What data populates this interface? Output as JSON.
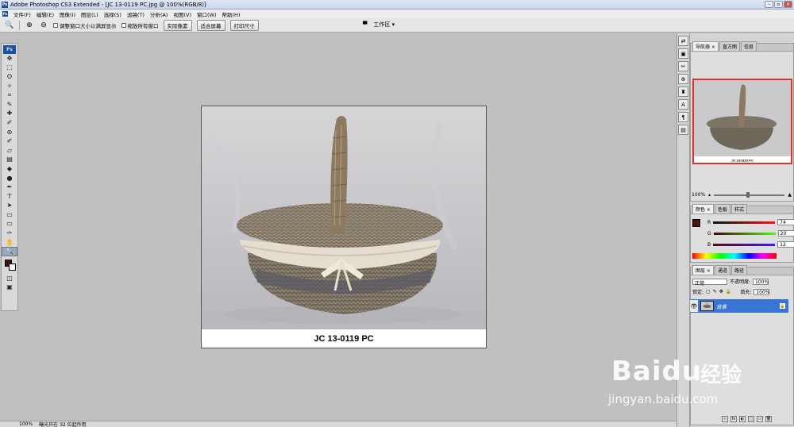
{
  "window": {
    "title": "Adobe Photoshop CS3 Extended - [JC 13-0119 PC.jpg @ 100%(RGB/8)]",
    "app_icon": "Ps",
    "minimize": "–",
    "restore": "▫",
    "close": "×"
  },
  "menubar": {
    "icon": "Ps",
    "items": [
      "文件(F)",
      "编辑(E)",
      "图像(I)",
      "图层(L)",
      "选择(S)",
      "滤镜(T)",
      "分析(A)",
      "视图(V)",
      "窗口(W)",
      "帮助(H)"
    ]
  },
  "options": {
    "zoom_in": "⊕",
    "zoom_out": "⊖",
    "resize_windows": "调整窗口大小以满屏显示",
    "zoom_all": "缩放所有窗口",
    "actual_pixels": "实际像素",
    "fit_screen": "适合屏幕",
    "print_size": "打印尺寸",
    "workspace": "工作区 ▾"
  },
  "toolbox": {
    "logo": "Ps",
    "tools": [
      "move",
      "marquee",
      "lasso",
      "magic-wand",
      "crop",
      "slice",
      "healing",
      "brush",
      "stamp",
      "history-brush",
      "eraser",
      "gradient",
      "blur",
      "dodge",
      "pen",
      "type",
      "path-select",
      "shape",
      "notes",
      "eyedropper",
      "hand",
      "zoom"
    ],
    "tool_glyphs": [
      "✥",
      "⬚",
      "ʘ",
      "✧",
      "⌗",
      "✎",
      "✚",
      "✐",
      "⊛",
      "✐",
      "▱",
      "▤",
      "◆",
      "●",
      "✒",
      "T",
      "➤",
      "▭",
      "▭",
      "✑",
      "✋",
      "🔍"
    ],
    "foreground": "#4a140c",
    "background": "#ffffff"
  },
  "document": {
    "caption": "JC 13-0119 PC"
  },
  "dock": {
    "icons": [
      "⇄",
      "▣",
      "✂",
      "⊕",
      "♜",
      "A",
      "¶",
      "▤"
    ]
  },
  "navigator": {
    "tabs": [
      "导航器 ×",
      "直方图",
      "信息"
    ],
    "zoom": "100%"
  },
  "color_panel": {
    "tabs": [
      "颜色 ×",
      "色板",
      "样式"
    ],
    "r_label": "R",
    "r_value": "74",
    "g_label": "G",
    "g_value": "20",
    "b_label": "B",
    "b_value": "12",
    "color": "#4a140c"
  },
  "layers": {
    "tabs": [
      "图层 ×",
      "通道",
      "路径"
    ],
    "blend_mode": "正常",
    "opacity_label": "不透明度:",
    "opacity": "100%",
    "lock_label": "锁定:",
    "fill_label": "填充:",
    "fill": "100%",
    "layer_name": "背景",
    "footer_icons": [
      "∞",
      "fx",
      "◐",
      "▢",
      "▭",
      "🗑"
    ]
  },
  "status": {
    "zoom": "100%",
    "info": "曝光只在 32 位起作用"
  },
  "watermark": {
    "brand": "Baidu",
    "cn": "经验",
    "url": "jingyan.baidu.com"
  }
}
